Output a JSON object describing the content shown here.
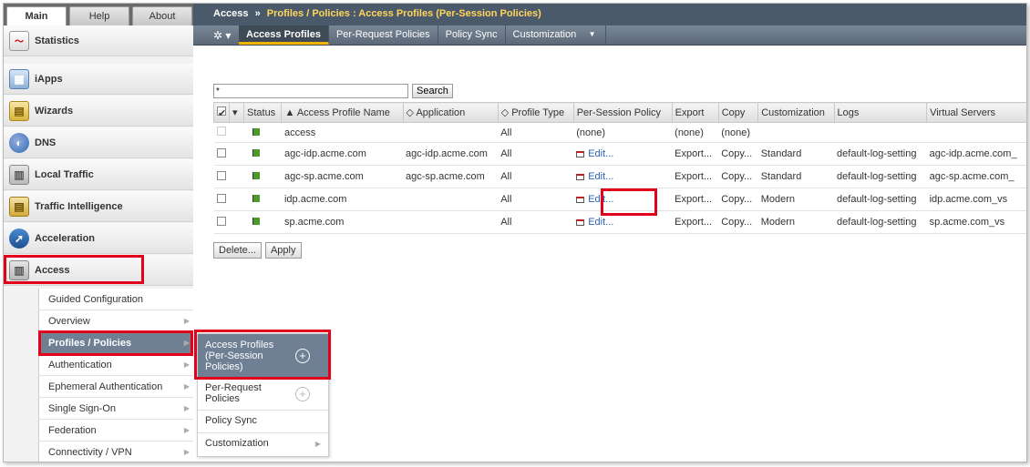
{
  "nav": {
    "tabs": [
      "Main",
      "Help",
      "About"
    ],
    "items": [
      {
        "label": "Statistics",
        "icon": "statistics-icon",
        "glyph": "〜"
      },
      {
        "label": "iApps",
        "icon": "iapps-icon",
        "glyph": "▦"
      },
      {
        "label": "Wizards",
        "icon": "wizards-icon",
        "glyph": "▤"
      },
      {
        "label": "DNS",
        "icon": "dns-icon",
        "glyph": "◐"
      },
      {
        "label": "Local Traffic",
        "icon": "local-traffic-icon",
        "glyph": "▥"
      },
      {
        "label": "Traffic Intelligence",
        "icon": "traffic-intelligence-icon",
        "glyph": "▤"
      },
      {
        "label": "Acceleration",
        "icon": "acceleration-icon",
        "glyph": "➚"
      },
      {
        "label": "Access",
        "icon": "access-icon",
        "glyph": "▥"
      }
    ],
    "access_menu": [
      "Guided Configuration",
      "Overview",
      "Profiles / Policies",
      "Authentication",
      "Ephemeral Authentication",
      "Single Sign-On",
      "Federation",
      "Connectivity / VPN"
    ],
    "flyout": [
      "Access Profiles (Per-Session Policies)",
      "Per-Request Policies",
      "Policy Sync",
      "Customization"
    ]
  },
  "breadcrumb": {
    "root": "Access",
    "sep": "»",
    "path": "Profiles / Policies : Access Profiles (Per-Session Policies)"
  },
  "tabs": [
    "Access Profiles",
    "Per-Request Policies",
    "Policy Sync",
    "Customization"
  ],
  "search": {
    "value": "*",
    "button": "Search"
  },
  "table": {
    "headers": [
      "Status",
      "▲ Access Profile Name",
      "◇ Application",
      "◇ Profile Type",
      "Per-Session Policy",
      "Export",
      "Copy",
      "Customization",
      "Logs",
      "Virtual Servers"
    ],
    "rows": [
      {
        "name": "access",
        "app": "",
        "type": "All",
        "policy": "(none)",
        "export": "(none)",
        "copy": "(none)",
        "cust": "",
        "logs": "",
        "vs": ""
      },
      {
        "name": "agc-idp.acme.com",
        "app": "agc-idp.acme.com",
        "type": "All",
        "policy": "Edit...",
        "export": "Export...",
        "copy": "Copy...",
        "cust": "Standard",
        "logs": "default-log-setting",
        "vs": "agc-idp.acme.com_"
      },
      {
        "name": "agc-sp.acme.com",
        "app": "agc-sp.acme.com",
        "type": "All",
        "policy": "Edit...",
        "export": "Export...",
        "copy": "Copy...",
        "cust": "Standard",
        "logs": "default-log-setting",
        "vs": "agc-sp.acme.com_"
      },
      {
        "name": "idp.acme.com",
        "app": "",
        "type": "All",
        "policy": "Edit...",
        "export": "Export...",
        "copy": "Copy...",
        "cust": "Modern",
        "logs": "default-log-setting",
        "vs": "idp.acme.com_vs"
      },
      {
        "name": "sp.acme.com",
        "app": "",
        "type": "All",
        "policy": "Edit...",
        "export": "Export...",
        "copy": "Copy...",
        "cust": "Modern",
        "logs": "default-log-setting",
        "vs": "sp.acme.com_vs"
      }
    ]
  },
  "actions": [
    "Delete...",
    "Apply"
  ],
  "colors": {
    "highlight": "#e3001b",
    "selected": "#6f7f94",
    "link": "#2a62b3",
    "crumb_path": "#ffd55a"
  }
}
